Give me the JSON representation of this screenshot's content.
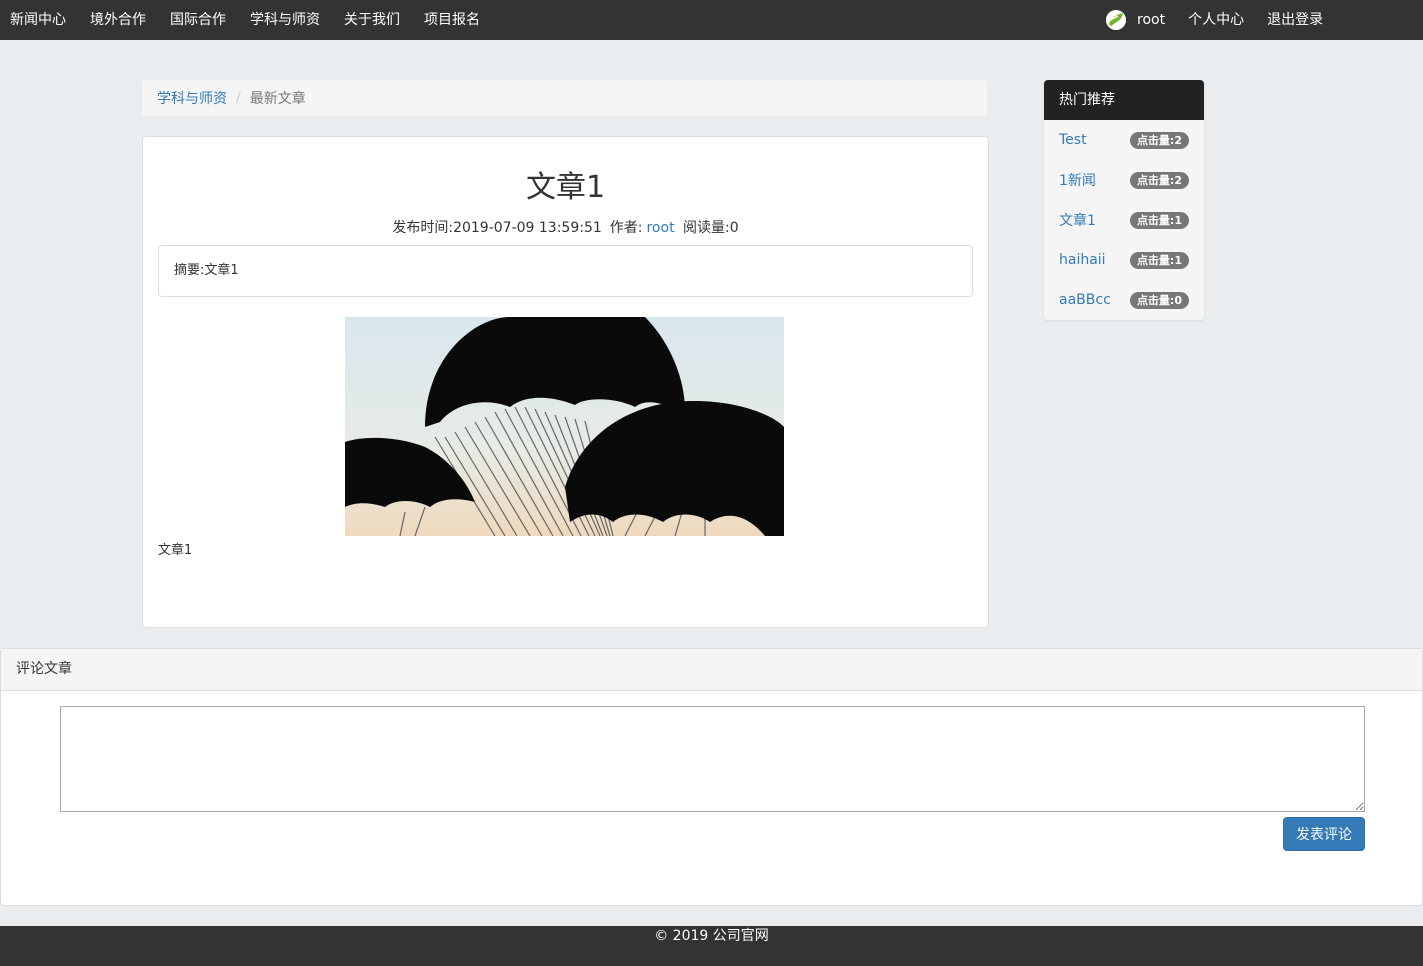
{
  "nav": {
    "items": [
      "新闻中心",
      "境外合作",
      "国际合作",
      "学科与师资",
      "关于我们",
      "项目报名"
    ],
    "user": "root",
    "profile": "个人中心",
    "logout": "退出登录"
  },
  "breadcrumb": {
    "parent": "学科与师资",
    "current": "最新文章"
  },
  "article": {
    "title": "文章1",
    "publish_label": "发布时间:2019-07-09 13:59:51",
    "author_label": "作者:",
    "author": "root",
    "reads_label": "阅读量:0",
    "summary": "摘要:文章1",
    "body": "文章1"
  },
  "hot": {
    "title": "热门推荐",
    "items": [
      {
        "label": "Test",
        "badge": "点击量:2"
      },
      {
        "label": "1新闻",
        "badge": "点击量:2"
      },
      {
        "label": "文章1",
        "badge": "点击量:1"
      },
      {
        "label": "haihaii",
        "badge": "点击量:1"
      },
      {
        "label": "aaBBcc",
        "badge": "点击量:0"
      }
    ]
  },
  "comment": {
    "title": "评论文章",
    "submit": "发表评论"
  },
  "footer": {
    "text": "© 2019 公司官网"
  },
  "colors": {
    "nav_bg": "#333333",
    "link": "#337ab7",
    "button": "#337ab7",
    "badge": "#777777"
  }
}
